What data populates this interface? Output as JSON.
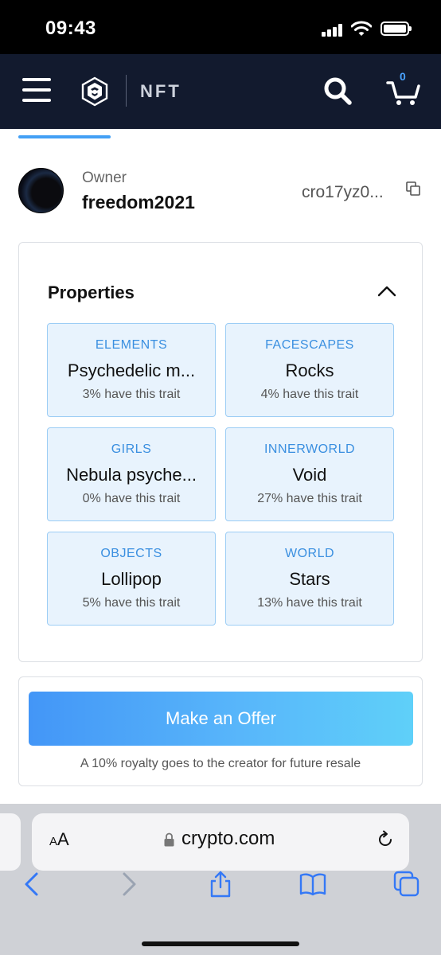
{
  "status_bar": {
    "time": "09:43"
  },
  "app_header": {
    "section_label": "NFT",
    "cart_count": "0"
  },
  "owner": {
    "label": "Owner",
    "name": "freedom2021",
    "address": "cro17yz0..."
  },
  "properties": {
    "title": "Properties",
    "traits": [
      {
        "category": "ELEMENTS",
        "value": "Psychedelic m...",
        "rarity": "3% have this trait"
      },
      {
        "category": "FACESCAPES",
        "value": "Rocks",
        "rarity": "4% have this trait"
      },
      {
        "category": "GIRLS",
        "value": "Nebula psyche...",
        "rarity": "0% have this trait"
      },
      {
        "category": "INNERWORLD",
        "value": "Void",
        "rarity": "27% have this trait"
      },
      {
        "category": "OBJECTS",
        "value": "Lollipop",
        "rarity": "5% have this trait"
      },
      {
        "category": "WORLD",
        "value": "Stars",
        "rarity": "13% have this trait"
      }
    ]
  },
  "offer": {
    "button_label": "Make an Offer",
    "royalty_note": "A 10% royalty goes to the creator for future resale"
  },
  "browser": {
    "text_size_small": "A",
    "text_size_large": "A",
    "url": "crypto.com"
  },
  "colors": {
    "header_bg": "#121a2e",
    "accent_blue": "#43a0f5",
    "trait_bg": "#e8f3fd",
    "trait_border": "#9ccdf5",
    "ios_blue": "#3478f6"
  },
  "icons": [
    "hamburger-icon",
    "crypto-com-logo",
    "search-icon",
    "cart-icon",
    "copy-icon",
    "chevron-up-icon",
    "lock-icon",
    "reload-icon",
    "back-icon",
    "forward-icon",
    "share-icon",
    "bookmarks-icon",
    "tabs-icon"
  ]
}
